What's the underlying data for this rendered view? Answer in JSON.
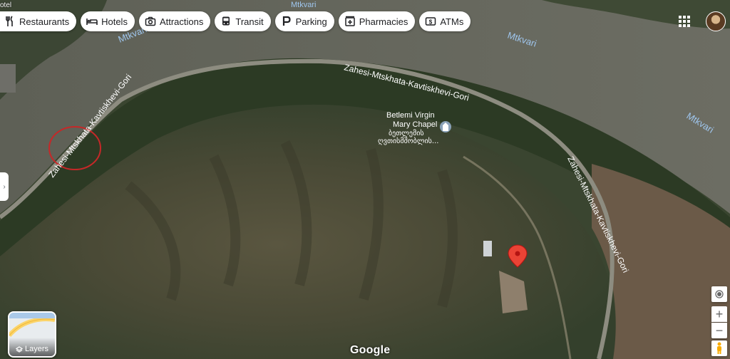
{
  "top_fragment": "otel",
  "categories": [
    {
      "label": "Restaurants",
      "icon": "fork-knife-icon"
    },
    {
      "label": "Hotels",
      "icon": "bed-icon"
    },
    {
      "label": "Attractions",
      "icon": "camera-icon"
    },
    {
      "label": "Transit",
      "icon": "bus-icon"
    },
    {
      "label": "Parking",
      "icon": "parking-icon"
    },
    {
      "label": "Pharmacies",
      "icon": "pharmacy-icon"
    },
    {
      "label": "ATMs",
      "icon": "atm-icon"
    }
  ],
  "map": {
    "river_labels": [
      "Mtkvari",
      "Mtkvari",
      "Mtkvari",
      "Mtkvari"
    ],
    "road_label": "Zahesi-Mtskhata-Kavtiskhevi-Gori",
    "poi": {
      "name_line1": "Betlemi Virgin",
      "name_line2": "Mary Chapel",
      "local_line1": "ბეთლემის",
      "local_line2": "ღვთისმშობლის..."
    },
    "pin_color": "#ea4335",
    "annotation_color": "#c62828"
  },
  "controls": {
    "layers_label": "Layers",
    "zoom_in": "+",
    "zoom_out": "−",
    "side_tab": "›"
  },
  "logo": "Google"
}
